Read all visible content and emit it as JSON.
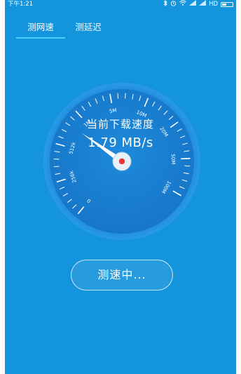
{
  "status_bar": {
    "time": "下午1:21",
    "network_label": "HD",
    "icons": [
      "bluetooth-icon",
      "alarm-icon",
      "wifi-icon",
      "signal-icon",
      "signal-icon",
      "battery-icon"
    ]
  },
  "tabs": [
    {
      "label": "测网速",
      "active": true
    },
    {
      "label": "测延迟",
      "active": false
    }
  ],
  "gauge": {
    "tick_labels": [
      "0",
      "256k",
      "512k",
      "1M",
      "5M",
      "10M",
      "20M",
      "50M",
      "100M"
    ],
    "title": "当前下载速度",
    "value": "1.79 MB/s",
    "needle_position": 2.62
  },
  "button": {
    "label": "测速中..."
  },
  "colors": {
    "background": "#1494dc",
    "gauge_inner": "#1b7fd4",
    "accent": "#47d3ff",
    "needle_center": "#e53935"
  }
}
